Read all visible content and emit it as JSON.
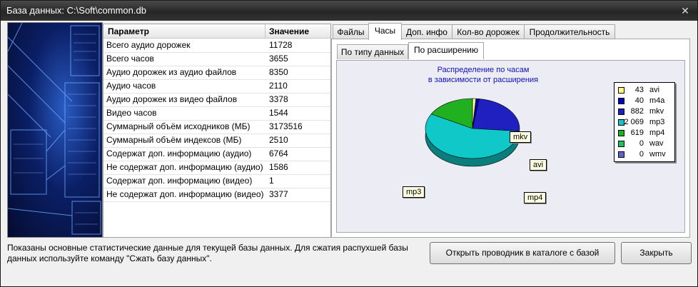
{
  "window": {
    "title": "База данных: C:\\Soft\\common.db",
    "close_glyph": "✕"
  },
  "grid": {
    "columns": [
      "Параметр",
      "Значение"
    ],
    "rows": [
      [
        "Всего аудио дорожек",
        "11728"
      ],
      [
        "Всего часов",
        "3655"
      ],
      [
        "Аудио дорожек из аудио файлов",
        "8350"
      ],
      [
        "Аудио часов",
        "2110"
      ],
      [
        "Аудио дорожек из видео файлов",
        "3378"
      ],
      [
        "Видео часов",
        "1544"
      ],
      [
        "Суммарный объём исходников (МБ)",
        "3173516"
      ],
      [
        "Суммарный объём индексов  (МБ)",
        "2510"
      ],
      [
        "Содержат доп. информацию (аудио)",
        "6764"
      ],
      [
        "Не содержат доп. информацию (аудио)",
        "1586"
      ],
      [
        "Содержат доп. информацию (видео)",
        "1"
      ],
      [
        "Не содержат доп. информацию (видео)",
        "3377"
      ]
    ]
  },
  "tabs": [
    "Файлы",
    "Часы",
    "Доп. инфо",
    "Кол-во дорожек",
    "Продолжительность"
  ],
  "subtabs": [
    "По типу данных",
    "По расширению"
  ],
  "chart_data": {
    "type": "pie",
    "title": "Распределение по часам\nв зависимости от расширения",
    "slices": [
      {
        "label": "avi",
        "value": 43,
        "display": "43",
        "color": "#ffff80"
      },
      {
        "label": "m4a",
        "value": 40,
        "display": "40",
        "color": "#0000c0"
      },
      {
        "label": "mkv",
        "value": 882,
        "display": "882",
        "color": "#2020c0"
      },
      {
        "label": "mp3",
        "value": 2069,
        "display": "2 069",
        "color": "#10c8c8"
      },
      {
        "label": "mp4",
        "value": 619,
        "display": "619",
        "color": "#20b020"
      },
      {
        "label": "wav",
        "value": 0,
        "display": "0",
        "color": "#20c060"
      },
      {
        "label": "wmv",
        "value": 0,
        "display": "0",
        "color": "#6060d0"
      }
    ],
    "callouts": [
      "mkv",
      "avi",
      "mp3",
      "mp4"
    ],
    "legend": "right"
  },
  "status": {
    "text": "Показаны основные статистические данные для текущей базы данных. Для сжатия распухшей базы данных используйте команду \"Сжать базу данных\"."
  },
  "buttons": {
    "open_explorer": "Открыть проводник в каталоге с базой",
    "close": "Закрыть"
  }
}
